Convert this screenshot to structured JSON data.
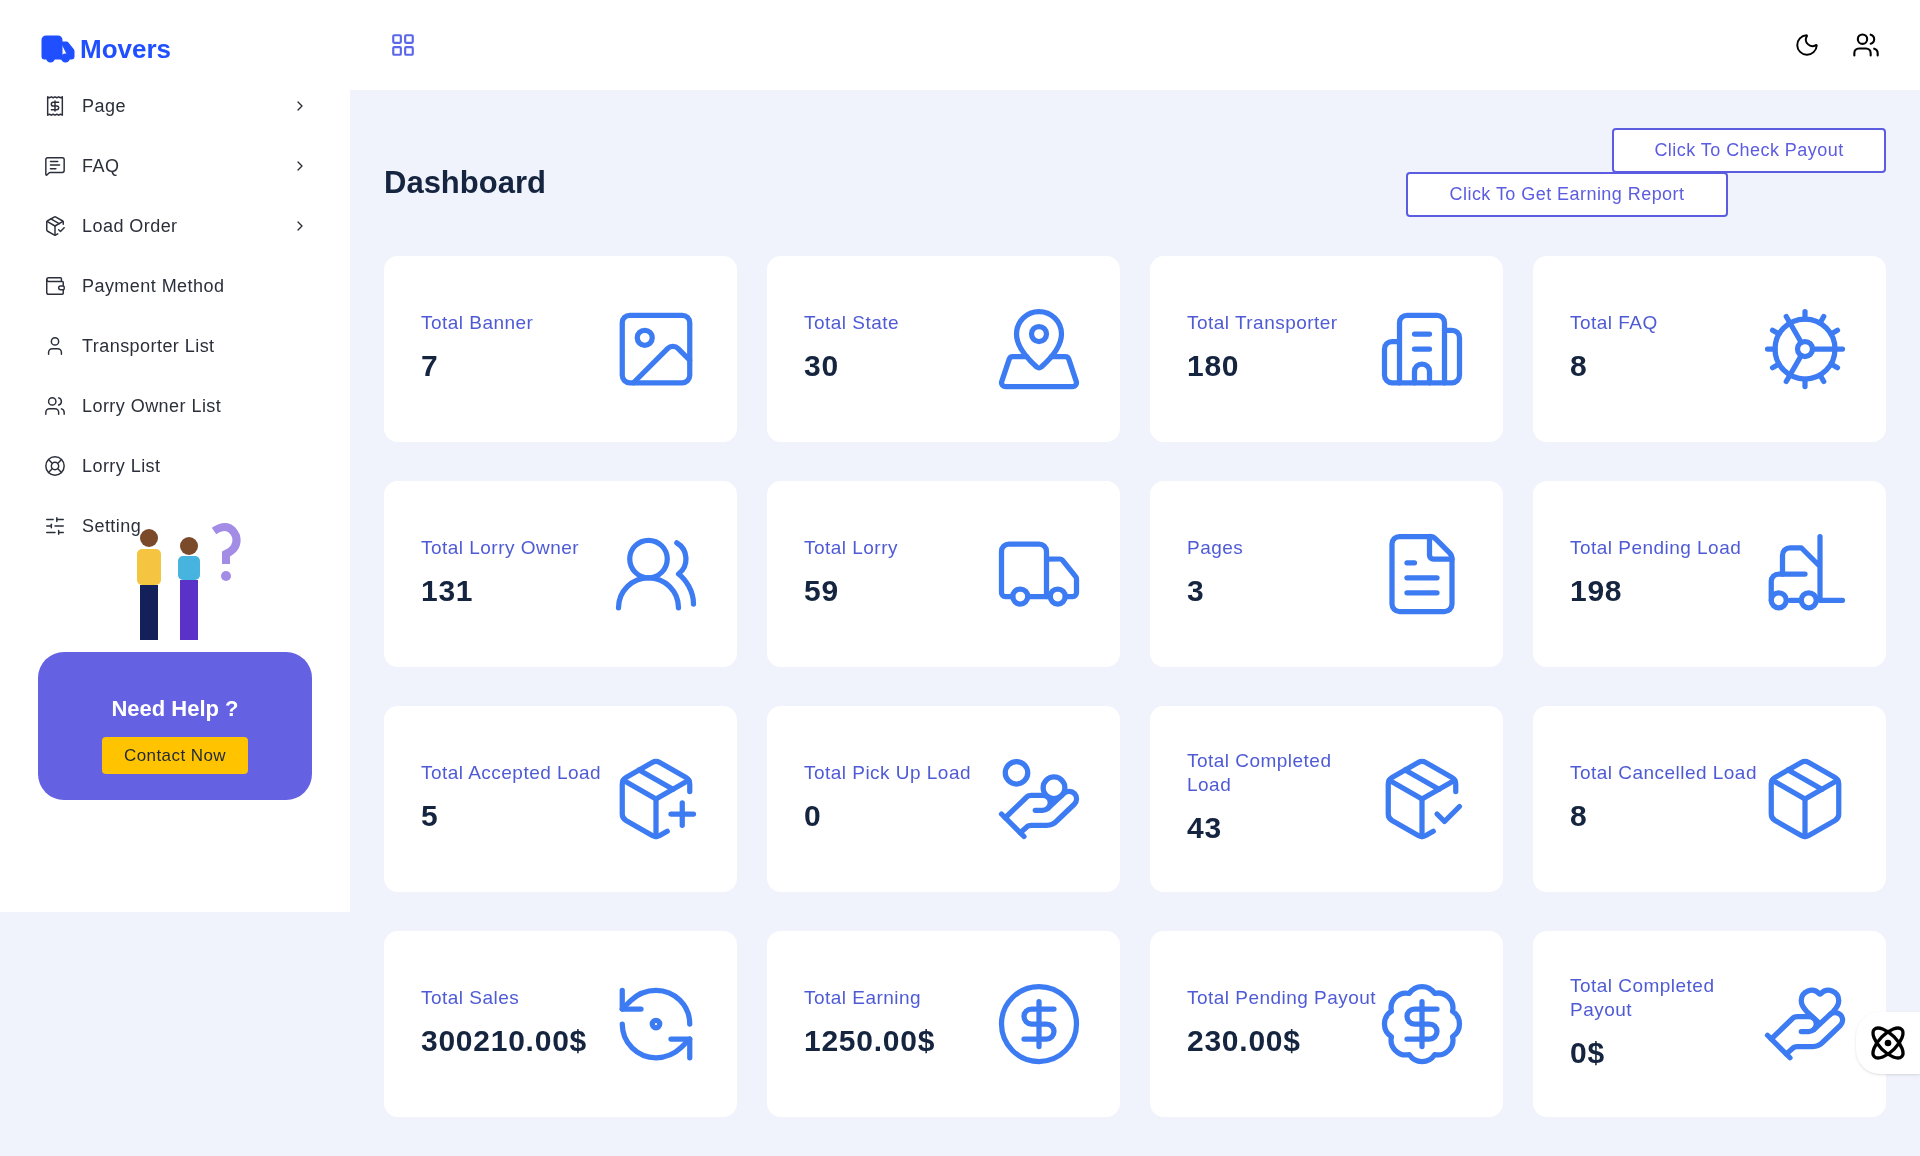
{
  "brand": "Movers",
  "sidebar": {
    "items": [
      {
        "label": "Page",
        "has_submenu": true
      },
      {
        "label": "FAQ",
        "has_submenu": true
      },
      {
        "label": "Load Order",
        "has_submenu": true
      },
      {
        "label": "Payment Method",
        "has_submenu": false
      },
      {
        "label": "Transporter List",
        "has_submenu": false
      },
      {
        "label": "Lorry Owner List",
        "has_submenu": false
      },
      {
        "label": "Lorry List",
        "has_submenu": false
      },
      {
        "label": "Setting",
        "has_submenu": false
      }
    ],
    "help": {
      "title": "Need Help ?",
      "button": "Contact Now"
    }
  },
  "page_title": "Dashboard",
  "buttons": [
    "Click To Check Payout",
    "Click To Get Earning Report"
  ],
  "cards": [
    {
      "label": "Total Banner",
      "value": "7"
    },
    {
      "label": "Total State",
      "value": "30"
    },
    {
      "label": "Total Transporter",
      "value": "180"
    },
    {
      "label": "Total FAQ",
      "value": "8"
    },
    {
      "label": "Total Lorry Owner",
      "value": "131"
    },
    {
      "label": "Total Lorry",
      "value": "59"
    },
    {
      "label": "Pages",
      "value": "3"
    },
    {
      "label": "Total Pending Load",
      "value": "198"
    },
    {
      "label": "Total Accepted Load",
      "value": "5"
    },
    {
      "label": "Total Pick Up Load",
      "value": "0"
    },
    {
      "label": "Total Completed Load",
      "value": "43"
    },
    {
      "label": "Total Cancelled Load",
      "value": "8"
    },
    {
      "label": "Total Sales",
      "value": "300210.00$"
    },
    {
      "label": "Total Earning",
      "value": "1250.00$"
    },
    {
      "label": "Total Pending Payout",
      "value": "230.00$"
    },
    {
      "label": "Total Completed Payout",
      "value": "0$"
    }
  ]
}
